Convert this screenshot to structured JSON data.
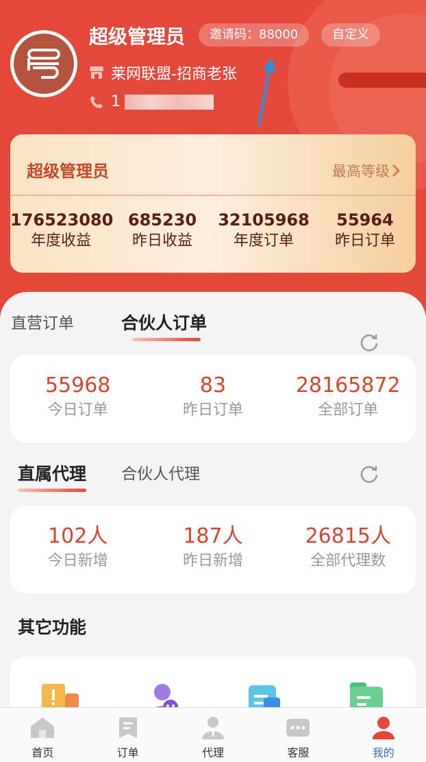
{
  "profile": {
    "name": "超级管理员",
    "invite_code": "邀请码：88000",
    "custom_label": "自定义",
    "store": "莱网联盟-招商老张",
    "phone_prefix": "1"
  },
  "level_card": {
    "title": "超级管理员",
    "link": "最高等级",
    "stats": [
      {
        "value": "176523080",
        "label": "年度收益"
      },
      {
        "value": "685230",
        "label": "昨日收益"
      },
      {
        "value": "32105968",
        "label": "年度订单"
      },
      {
        "value": "55964",
        "label": "昨日订单"
      }
    ]
  },
  "order_section": {
    "tabs": [
      "直营订单",
      "合伙人订单"
    ],
    "active_tab": "合伙人订单",
    "stats": [
      {
        "value": "55968",
        "label": "今日订单"
      },
      {
        "value": "83",
        "label": "昨日订单"
      },
      {
        "value": "28165872",
        "label": "全部订单"
      }
    ]
  },
  "agent_section": {
    "tabs": [
      "直属代理",
      "合伙人代理"
    ],
    "active_tab": "直属代理",
    "stats": [
      {
        "value": "102人",
        "label": "今日新增"
      },
      {
        "value": "187人",
        "label": "昨日新增"
      },
      {
        "value": "26815人",
        "label": "全部代理数"
      }
    ]
  },
  "other_functions": {
    "title": "其它功能"
  },
  "bottom_nav": [
    {
      "label": "首页",
      "icon": "home-icon"
    },
    {
      "label": "订单",
      "icon": "order-icon"
    },
    {
      "label": "代理",
      "icon": "agent-icon"
    },
    {
      "label": "客服",
      "icon": "chat-icon"
    },
    {
      "label": "我的",
      "icon": "profile-icon"
    }
  ],
  "colors": {
    "brand_red": "#e4483a",
    "value_red": "#d64532",
    "nav_active": "#3c68d8"
  }
}
